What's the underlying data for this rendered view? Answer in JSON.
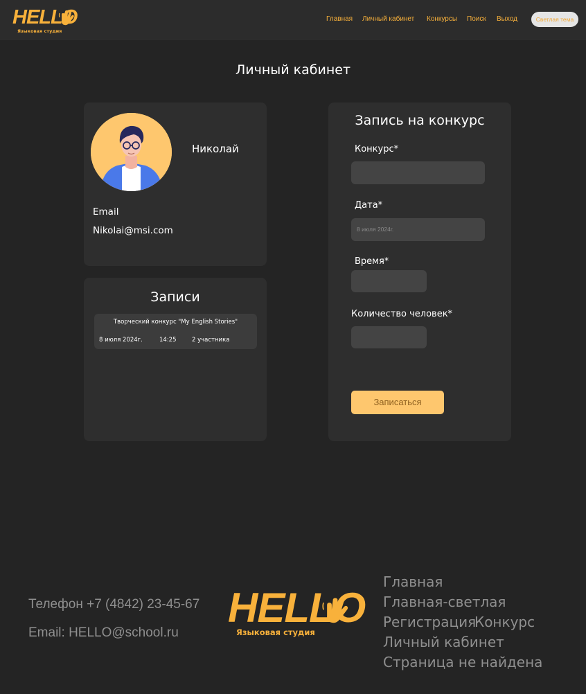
{
  "brand": {
    "logo_text": "HELLO",
    "logo_subtitle": "Языковая студия",
    "accent_color": "#f8b13b",
    "hand_icon": "waving-hand-icon"
  },
  "header": {
    "nav": [
      "Главная",
      "Личный кабинет",
      "Конкурсы",
      "Поиск",
      "Выход"
    ],
    "theme_button": "Светлая тема"
  },
  "page": {
    "title": "Личный кабинет"
  },
  "profile": {
    "avatar_icon": "user-avatar",
    "name": "Николай",
    "email_label": "Email",
    "email": "Nikolai@msi.com"
  },
  "records": {
    "title": "Записи",
    "items": [
      {
        "title": "Творческий конкурс \"My English Stories\"",
        "date": "8 июля 2024г.",
        "time": "14:25",
        "people": "2 участника"
      }
    ]
  },
  "form": {
    "title": "Запись на конкурс",
    "contest_label": "Конкурс*",
    "contest_value": "",
    "date_label": "Дата*",
    "date_placeholder": "8 июля 2024г.",
    "time_label": "Время*",
    "time_value": "",
    "people_label": "Количество человек*",
    "people_value": "",
    "submit": "Записаться"
  },
  "footer": {
    "phone": "Телефон +7 (4842) 23-45-67",
    "email": "Email: HELLO@school.ru",
    "links": [
      "Главная",
      "Главная-светлая",
      "Регистрация",
      "Конкурс",
      "Личный кабинет",
      "Страница не найдена"
    ]
  }
}
